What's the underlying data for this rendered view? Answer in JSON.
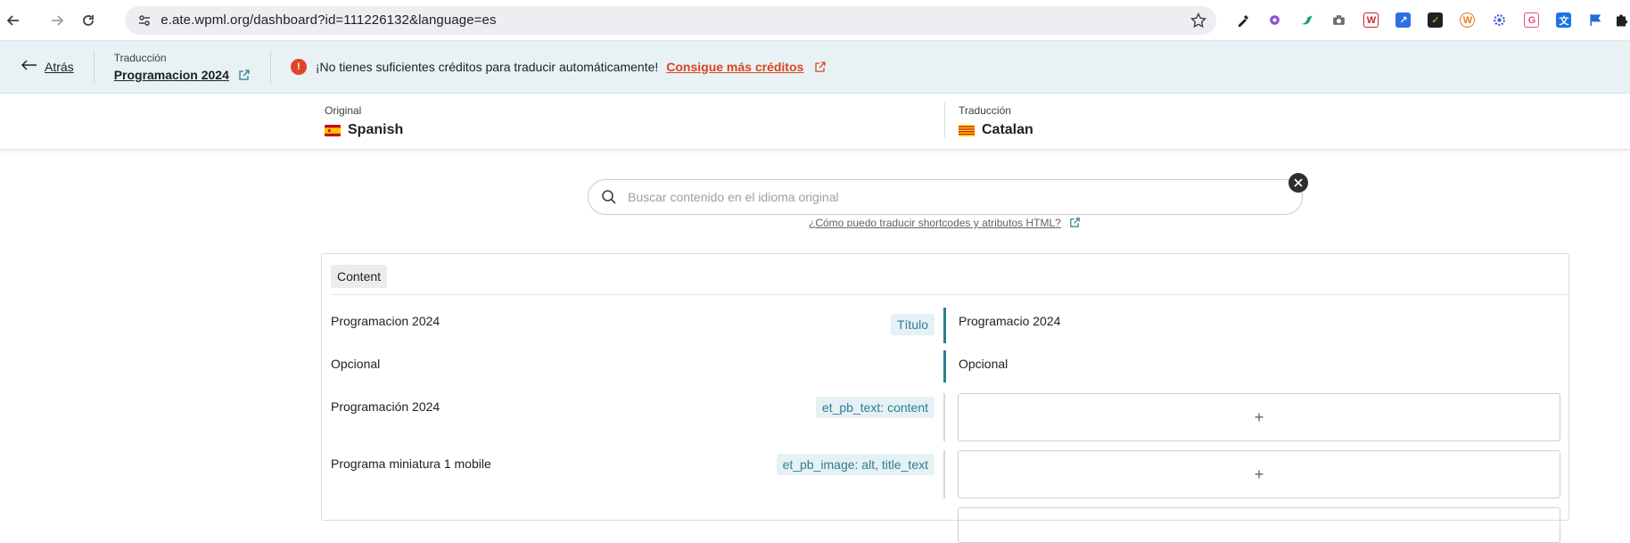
{
  "browser": {
    "url": "e.ate.wpml.org/dashboard?id=111226132&language=es"
  },
  "topbar": {
    "back_label": "Atrás",
    "translation_label": "Traducción",
    "translation_title": "Programacion 2024",
    "warning_text": "¡No tienes suficientes créditos para traducir automáticamente!",
    "credits_link": "Consigue más créditos"
  },
  "languages": {
    "original_label": "Original",
    "original_name": "Spanish",
    "translation_label": "Traducción",
    "translation_name": "Catalan"
  },
  "search": {
    "placeholder": "Buscar contenido en el idioma original",
    "help_link": "¿Cómo puedo traducir shortcodes y atributos HTML?"
  },
  "content": {
    "section_label": "Content",
    "rows": [
      {
        "source": "Programacion 2024",
        "tag": "Título",
        "target": "Programacio 2024"
      },
      {
        "source": "Opcional",
        "tag": "",
        "target": "Opcional"
      },
      {
        "source": "Programación 2024",
        "tag": "et_pb_text: content",
        "target": "+"
      },
      {
        "source": "Programa miniatura 1 mobile",
        "tag": "et_pb_image: alt, title_text",
        "target": "+"
      }
    ]
  },
  "colors": {
    "accent": "#2f7d92",
    "warning": "#e0452b",
    "topbar_bg": "#e8f2f5"
  }
}
